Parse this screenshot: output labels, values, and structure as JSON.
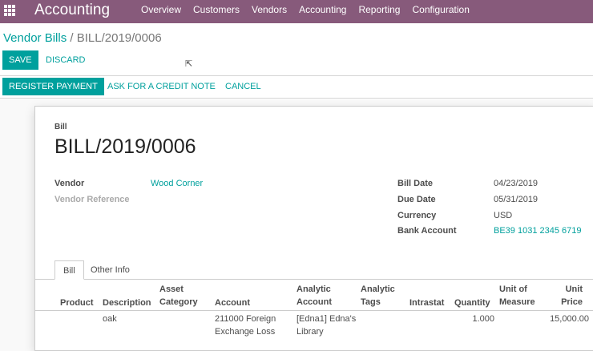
{
  "navbar": {
    "app_name": "Accounting",
    "menu": [
      "Overview",
      "Customers",
      "Vendors",
      "Accounting",
      "Reporting",
      "Configuration"
    ]
  },
  "breadcrumb": {
    "parent": "Vendor Bills",
    "separator": " / ",
    "current": "BILL/2019/0006"
  },
  "actions": {
    "save": "SAVE",
    "discard": "DISCARD"
  },
  "statusbar": {
    "register_payment": "REGISTER PAYMENT",
    "credit_note": "ASK FOR A CREDIT NOTE",
    "cancel": "CANCEL"
  },
  "sheet": {
    "title_label": "Bill",
    "title": "BILL/2019/0006",
    "vendor_label": "Vendor",
    "vendor_value": "Wood Corner",
    "vendor_reference_label": "Vendor Reference",
    "bill_date_label": "Bill Date",
    "bill_date_value": "04/23/2019",
    "due_date_label": "Due Date",
    "due_date_value": "05/31/2019",
    "currency_label": "Currency",
    "currency_value": "USD",
    "bank_account_label": "Bank Account",
    "bank_account_value": "BE39 1031 2345 6719"
  },
  "tabs": [
    "Bill",
    "Other Info"
  ],
  "table": {
    "headers": {
      "product": "Product",
      "description": "Description",
      "asset_category": [
        "Asset",
        "Category"
      ],
      "account": "Account",
      "analytic_account": [
        "Analytic",
        "Account"
      ],
      "analytic_tags": [
        "Analytic",
        "Tags"
      ],
      "intrastat": "Intrastat",
      "quantity": "Quantity",
      "uom": [
        "Unit of",
        "Measure"
      ],
      "unit_price": [
        "Unit",
        "Price"
      ]
    },
    "rows": [
      {
        "description": "oak",
        "account": [
          "211000 Foreign",
          "Exchange Loss"
        ],
        "analytic_account": [
          "[Edna1] Edna's",
          "Library"
        ],
        "quantity": "1.000",
        "unit_price": "15,000.00"
      }
    ]
  },
  "colors": {
    "navbar": "#875a7b",
    "accent": "#00a09d"
  }
}
